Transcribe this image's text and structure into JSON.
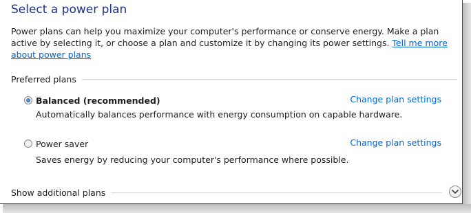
{
  "header": {
    "title": "Select a power plan"
  },
  "intro": {
    "text": "Power plans can help you maximize your computer's performance or conserve energy. Make a plan active by selecting it, or choose a plan and customize it by changing its power settings. ",
    "link_text": "Tell me more about power plans"
  },
  "preferred": {
    "label": "Preferred plans",
    "plans": [
      {
        "name": "Balanced (recommended)",
        "selected": true,
        "change_label": "Change plan settings",
        "description": "Automatically balances performance with energy consumption on capable hardware."
      },
      {
        "name": "Power saver",
        "selected": false,
        "change_label": "Change plan settings",
        "description": "Saves energy by reducing your computer's performance where possible."
      }
    ]
  },
  "additional": {
    "label": "Show additional plans",
    "icon": "chevron-down-icon"
  },
  "colors": {
    "title": "#1e3287",
    "link": "#0066cc"
  }
}
